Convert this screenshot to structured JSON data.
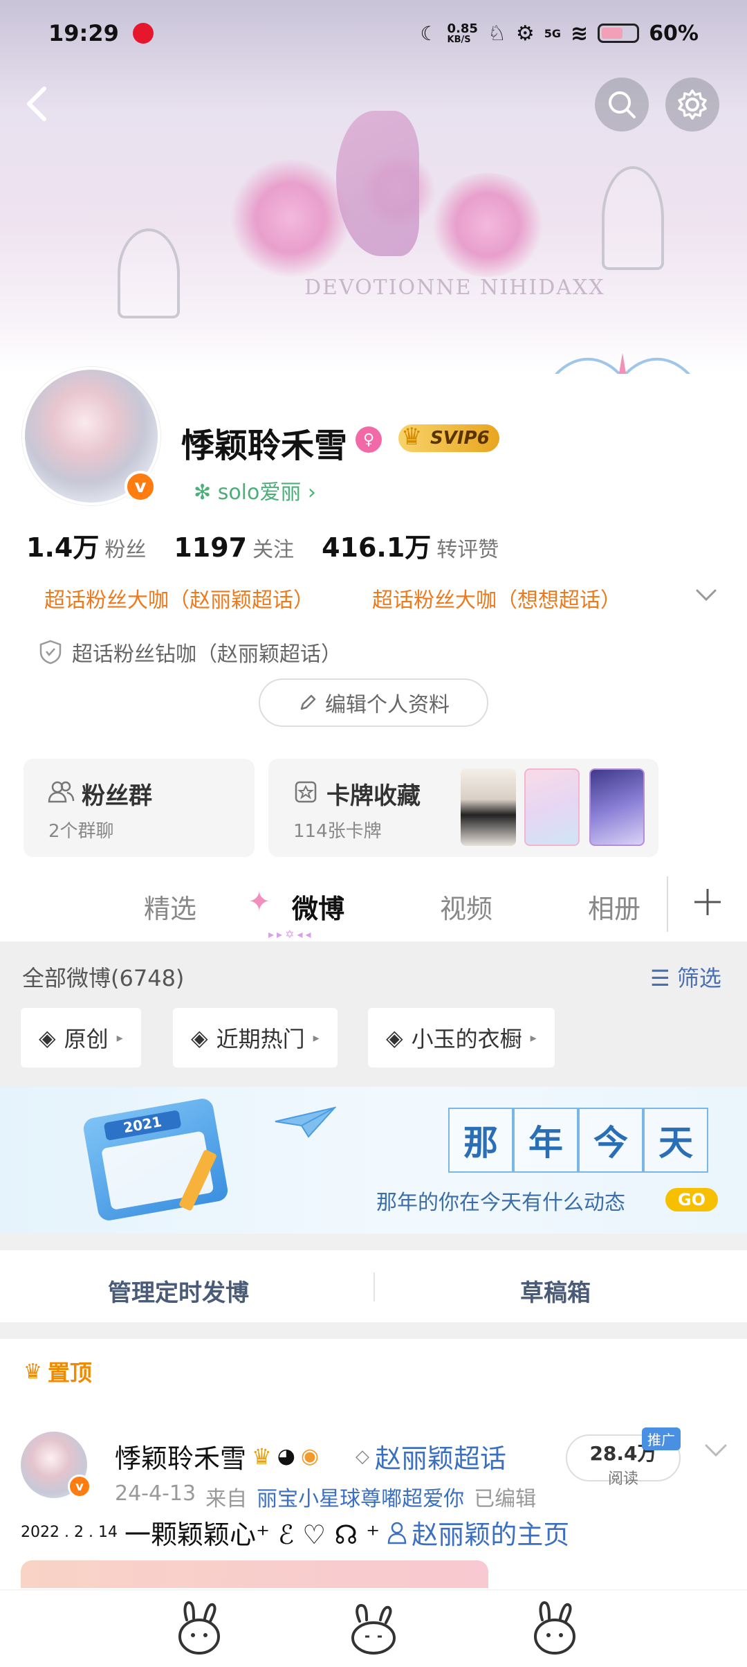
{
  "status_bar": {
    "time": "19:29",
    "net_speed": "0.85",
    "net_unit": "KB/S",
    "net_type": "5G",
    "battery": "60%",
    "icons": [
      "weibo-icon",
      "nfc-icon",
      "network-speed",
      "notification-icon",
      "settings-icon",
      "signal-icon",
      "wifi-icon",
      "battery-icon"
    ]
  },
  "banner": {
    "text": "DEVOTIONNE NIHIDAXX"
  },
  "header": {
    "back_icon": "chevron-left-icon",
    "search_icon": "search-icon",
    "settings_icon": "gear-icon"
  },
  "profile": {
    "name": "悸颖聆禾雪",
    "vip_level": "SVIP6",
    "group": "solo爱丽",
    "stats": [
      {
        "num": "1.4万",
        "label": "粉丝"
      },
      {
        "num": "1197",
        "label": "关注"
      },
      {
        "num": "416.1万",
        "label": "转评赞"
      }
    ],
    "fan_tags": [
      "超话粉丝大咖（赵丽颖超话）",
      "超话粉丝大咖（想想超话）"
    ],
    "diamond_tag": "超话粉丝钻咖（赵丽颖超话）",
    "edit_label": "编辑个人资料"
  },
  "cards": {
    "fans_group": {
      "title": "粉丝群",
      "sub": "2个群聊"
    },
    "card_collection": {
      "title": "卡牌收藏",
      "sub": "114张卡牌"
    }
  },
  "tabs": [
    "精选",
    "微博",
    "视频",
    "相册"
  ],
  "feed": {
    "all_posts": "全部微博(6748)",
    "filter": "筛选",
    "chips": [
      "原创",
      "近期热门",
      "小玉的衣橱"
    ]
  },
  "memory": {
    "title_chars": [
      "那",
      "年",
      "今",
      "天"
    ],
    "subtitle": "那年的你在今天有什么动态",
    "go": "GO",
    "calendar_year": "2021"
  },
  "manage": {
    "schedule": "管理定时发博",
    "drafts": "草稿箱"
  },
  "pinned": {
    "label": "置顶",
    "author": "悸颖聆禾雪",
    "topic": "赵丽颖超话",
    "reads_num": "28.4万",
    "reads_label": "阅读",
    "promo": "推广",
    "date": "24-4-13",
    "from": "来自",
    "source": "丽宝小星球尊嘟超爱你",
    "edited": "已编辑",
    "body_prefix": "2022 . 2 . 14",
    "body_text": "一颗颖颖心⁺ ℰ ♡ ☊ ⁺",
    "body_link": "赵丽颖的主页"
  },
  "colors": {
    "accent_orange": "#ee7a1e",
    "link_blue": "#3b6fc2",
    "svip_gold": "#e8a51f"
  }
}
